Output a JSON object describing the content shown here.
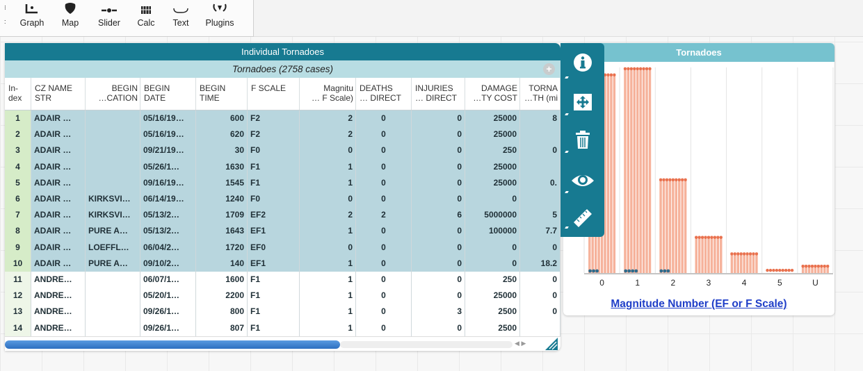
{
  "toolbar": {
    "items": [
      {
        "label": "Graph",
        "icon": "graph-icon"
      },
      {
        "label": "Map",
        "icon": "map-icon"
      },
      {
        "label": "Slider",
        "icon": "slider-icon"
      },
      {
        "label": "Calc",
        "icon": "calc-icon"
      },
      {
        "label": "Text",
        "icon": "text-icon"
      },
      {
        "label": "Plugins",
        "icon": "plugins-icon"
      }
    ]
  },
  "table": {
    "title": "Individual Tornadoes",
    "collection": "Tornadoes (2758 cases)",
    "add_symbol": "+",
    "columns": [
      {
        "l1": "In-",
        "l2": "dex"
      },
      {
        "l1": "CZ NAME",
        "l2": "STR"
      },
      {
        "l1": "BEGIN",
        "l2": "…CATION"
      },
      {
        "l1": "BEGIN",
        "l2": "DATE"
      },
      {
        "l1": "BEGIN",
        "l2": "TIME"
      },
      {
        "l1": "F SCALE",
        "l2": ""
      },
      {
        "l1": "Magnitu",
        "l2": "… F Scale)"
      },
      {
        "l1": "DEATHS",
        "l2": "… DIRECT"
      },
      {
        "l1": "INJURIES",
        "l2": "… DIRECT"
      },
      {
        "l1": "DAMAGE",
        "l2": "…TY COST"
      },
      {
        "l1": "TORNA",
        "l2": "…TH (mi"
      }
    ],
    "rows": [
      {
        "sel": true,
        "c": [
          "1",
          "ADAIR …",
          "",
          "05/16/19…",
          "600",
          "F2",
          "2",
          "0",
          "0",
          "25000",
          "8"
        ]
      },
      {
        "sel": true,
        "c": [
          "2",
          "ADAIR …",
          "",
          "05/16/19…",
          "620",
          "F2",
          "2",
          "0",
          "0",
          "25000",
          ""
        ]
      },
      {
        "sel": true,
        "c": [
          "3",
          "ADAIR …",
          "",
          "09/21/19…",
          "30",
          "F0",
          "0",
          "0",
          "0",
          "250",
          "0"
        ]
      },
      {
        "sel": true,
        "c": [
          "4",
          "ADAIR …",
          "",
          "05/26/1…",
          "1630",
          "F1",
          "1",
          "0",
          "0",
          "25000",
          ""
        ]
      },
      {
        "sel": true,
        "c": [
          "5",
          "ADAIR …",
          "",
          "09/16/19…",
          "1545",
          "F1",
          "1",
          "0",
          "0",
          "25000",
          "0."
        ]
      },
      {
        "sel": true,
        "c": [
          "6",
          "ADAIR …",
          "KIRKSVI…",
          "06/14/19…",
          "1240",
          "F0",
          "0",
          "0",
          "0",
          "0",
          ""
        ]
      },
      {
        "sel": true,
        "c": [
          "7",
          "ADAIR …",
          "KIRKSVI…",
          "05/13/2…",
          "1709",
          "EF2",
          "2",
          "2",
          "6",
          "5000000",
          "5"
        ]
      },
      {
        "sel": true,
        "c": [
          "8",
          "ADAIR …",
          "PURE A…",
          "05/13/2…",
          "1643",
          "EF1",
          "1",
          "0",
          "0",
          "100000",
          "7.7"
        ]
      },
      {
        "sel": true,
        "c": [
          "9",
          "ADAIR …",
          "LOEFFL…",
          "06/04/2…",
          "1720",
          "EF0",
          "0",
          "0",
          "0",
          "0",
          "0"
        ]
      },
      {
        "sel": true,
        "c": [
          "10",
          "ADAIR …",
          "PURE A…",
          "09/10/2…",
          "140",
          "EF1",
          "1",
          "0",
          "0",
          "0",
          "18.2"
        ]
      },
      {
        "sel": false,
        "c": [
          "11",
          "ANDRE…",
          "",
          "06/07/1…",
          "1600",
          "F1",
          "1",
          "0",
          "0",
          "250",
          "0"
        ]
      },
      {
        "sel": false,
        "c": [
          "12",
          "ANDRE…",
          "",
          "05/20/1…",
          "2200",
          "F1",
          "1",
          "0",
          "0",
          "25000",
          "0"
        ]
      },
      {
        "sel": false,
        "c": [
          "13",
          "ANDRE…",
          "",
          "09/26/1…",
          "800",
          "F1",
          "1",
          "0",
          "3",
          "2500",
          "0"
        ]
      },
      {
        "sel": false,
        "c": [
          "14",
          "ANDRE…",
          "",
          "09/26/1…",
          "807",
          "F1",
          "1",
          "0",
          "0",
          "2500",
          ""
        ]
      }
    ]
  },
  "inspector": {
    "buttons": [
      "info-icon",
      "rescale-icon",
      "trash-icon",
      "eye-icon",
      "ruler-icon"
    ]
  },
  "graph": {
    "title": "Tornadoes",
    "xaxis_label": "Magnitude Number (EF or F Scale)",
    "colors": {
      "unselected": "#f4a58a",
      "unselected_dot": "#e9714e",
      "selected_dot": "#2f6b8c"
    }
  },
  "chart_data": {
    "type": "dot-plot",
    "categories": [
      "0",
      "1",
      "2",
      "3",
      "4",
      "5",
      "U"
    ],
    "ylim": [
      0,
      1
    ],
    "stack_height_fraction": [
      0.97,
      1.0,
      0.46,
      0.18,
      0.1,
      0.02,
      0.04
    ],
    "selected_count": [
      3,
      4,
      3,
      0,
      0,
      0,
      0
    ],
    "xlabel": "Magnitude Number (EF or F Scale)"
  }
}
